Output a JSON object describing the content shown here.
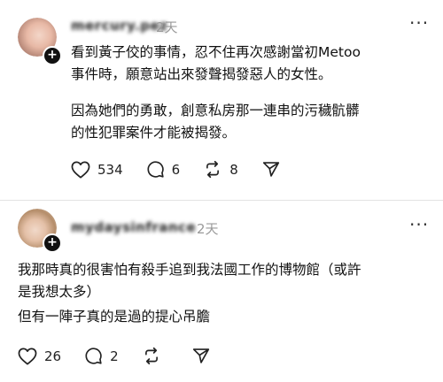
{
  "posts": [
    {
      "username": "mercury.pez",
      "time": "2天",
      "paragraphs": [
        [
          "看到黃子佼的事情，忍不住再次感謝當初Metoo",
          "事件時，願意站出來發聲揭發惡人的女性。"
        ],
        [
          "因為她們的勇敢，創意私房那一連串的污穢骯髒",
          "的性犯罪案件才能被揭發。"
        ]
      ],
      "likes": "534",
      "comments": "6",
      "reposts": "8"
    },
    {
      "username": "mydaysinfrance",
      "time": "2天",
      "paragraphs": [
        [
          "我那時真的很害怕有殺手追到我法國工作的博物館（或許",
          "是我想太多）",
          "但有一陣子真的是過的提心吊膽"
        ]
      ],
      "likes": "26",
      "comments": "2",
      "reposts": ""
    }
  ],
  "icons": {
    "like": "heart-icon",
    "comment": "comment-bubble-icon",
    "repost": "repost-icon",
    "share": "send-icon",
    "more": "more-options-icon",
    "follow": "plus-icon"
  },
  "colors": {
    "text": "#111111",
    "muted": "#9a9a9a",
    "divider": "#e3e3e3"
  }
}
